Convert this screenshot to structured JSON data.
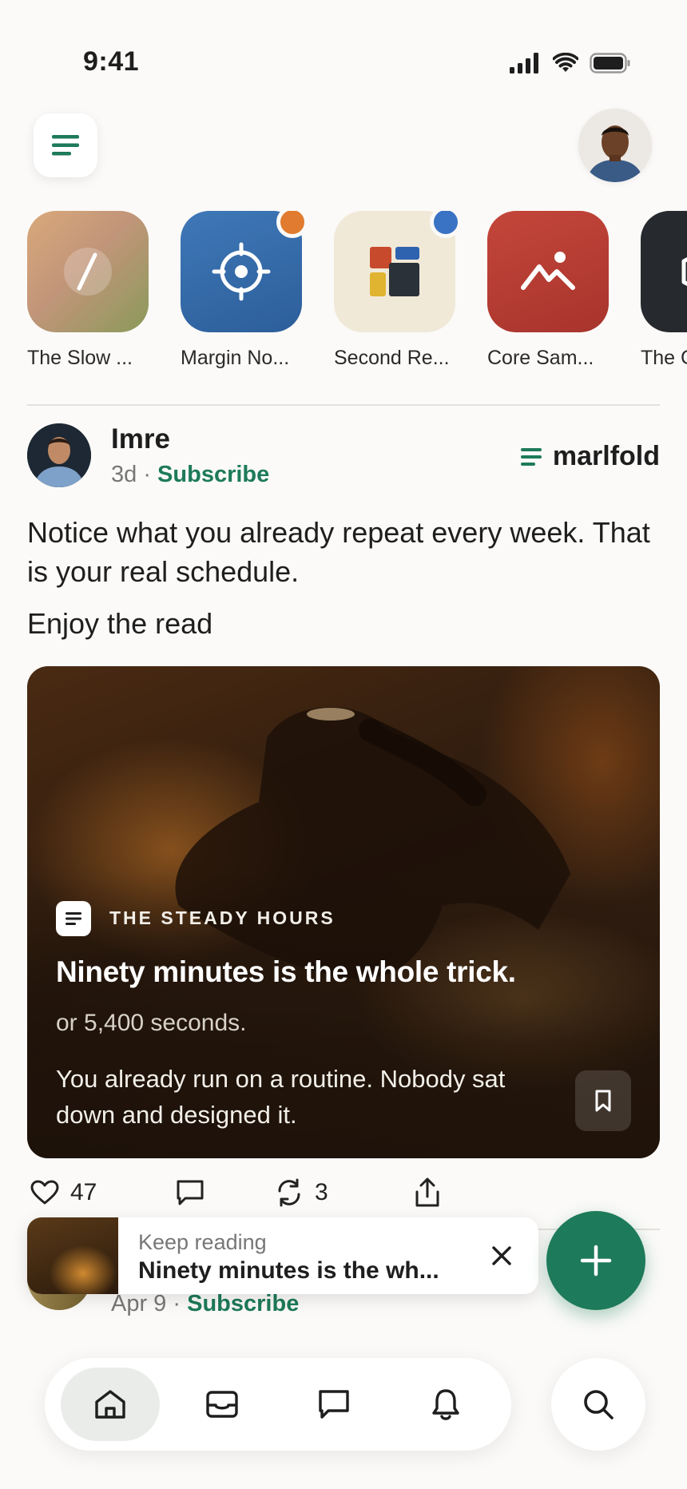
{
  "status_bar": {
    "time": "9:41"
  },
  "publications": [
    {
      "label": "The Slow ...",
      "has_dot": false
    },
    {
      "label": "Margin No...",
      "has_dot": true,
      "dot_color": "#e07b2f"
    },
    {
      "label": "Second Re...",
      "has_dot": true,
      "dot_color": "#3a72c4"
    },
    {
      "label": "Core Sam...",
      "has_dot": false
    },
    {
      "label": "The C",
      "has_dot": false
    }
  ],
  "post": {
    "author": "Imre",
    "age": "3d",
    "separator": " · ",
    "subscribe_label": "Subscribe",
    "brand": "marlfold",
    "text": "Notice what you already repeat every week. That is your real schedule.",
    "subtext": "Enjoy the read",
    "card": {
      "publication": "THE STEADY HOURS",
      "title": "Ninety minutes is the whole trick.",
      "subtitle": "or 5,400 seconds.",
      "excerpt": "You already run on a routine. Nobody sat down and designed it."
    },
    "likes": "47",
    "restacks": "3"
  },
  "next_post": {
    "date": "Apr 9",
    "separator": " · ",
    "subscribe_label": "Subscribe"
  },
  "keep_reading": {
    "label": "Keep reading",
    "title": "Ninety minutes is the wh..."
  },
  "colors": {
    "accent": "#1d7a5a",
    "background": "#fbfaf8"
  }
}
